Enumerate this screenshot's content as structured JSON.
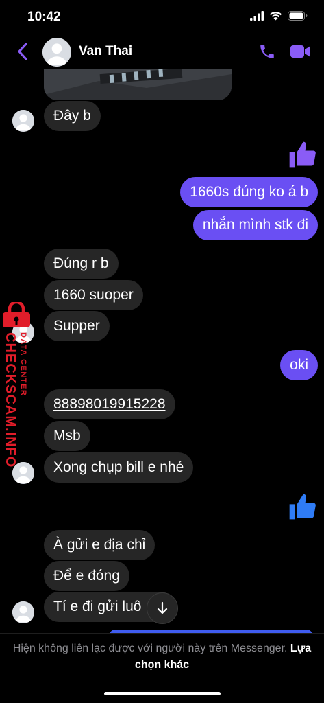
{
  "status_bar": {
    "time": "10:42"
  },
  "header": {
    "contact_name": "Van Thai"
  },
  "messages": {
    "in_1": "Đây b",
    "out_1": "1660s đúng ko á b",
    "out_2": "nhắn mình stk đi",
    "in_2": "Đúng r b",
    "in_3": "1660 suoper",
    "in_4": "Supper",
    "out_3": "oki",
    "in_5": "88898019915228",
    "in_6": "Msb",
    "in_7": "Xong chụp bill e nhé",
    "in_8": "À gửi e địa chỉ",
    "in_9": "Để e đóng",
    "in_10": "Tí e đi gửi luô"
  },
  "footer": {
    "notice": "Hiện không liên lạc được với người này trên Messenger.",
    "link": "Lựa chọn khác"
  },
  "watermark": {
    "main": "CHECKSCAM.INFO",
    "sub": "DATA CENTER"
  },
  "colors": {
    "accent": "#6a4ff3",
    "thumbs": "#2f7cf6",
    "received_bubble": "#262626",
    "watermark": "#e11d2a",
    "icon_purple": "#8a5cf6"
  },
  "icons": [
    "back-chevron-icon",
    "phone-icon",
    "video-camera-icon",
    "thumbs-up-icon",
    "arrow-down-icon",
    "lock-icon",
    "signal-icon",
    "wifi-icon",
    "battery-icon"
  ]
}
